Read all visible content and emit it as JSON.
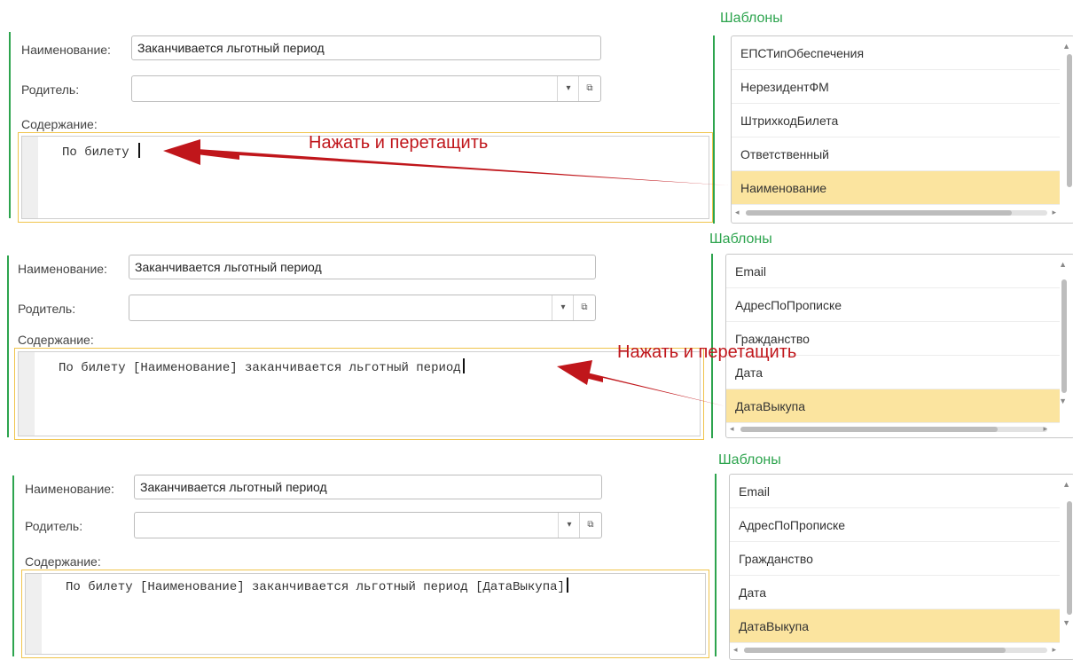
{
  "panels": [
    {
      "name_label": "Наименование:",
      "name_value": "Заканчивается льготный период",
      "parent_label": "Родитель:",
      "parent_value": "",
      "content_label": "Содержание:",
      "content_text": "По билету ",
      "templates_title": "Шаблоны",
      "templates": [
        "ЕПСТипОбеспечения",
        "НерезидентФМ",
        "ШтрихкодБилета",
        "Ответственный",
        "Наименование"
      ],
      "selected_index": 4,
      "annotation": "Нажать и перетащить"
    },
    {
      "name_label": "Наименование:",
      "name_value": "Заканчивается льготный период",
      "parent_label": "Родитель:",
      "parent_value": "",
      "content_label": "Содержание:",
      "content_text": "По билету [Наименование] заканчивается льготный период",
      "templates_title": "Шаблоны",
      "templates": [
        "Email",
        "АдресПоПрописке",
        "Гражданство",
        "Дата",
        "ДатаВыкупа"
      ],
      "selected_index": 4,
      "annotation": "Нажать и перетащить"
    },
    {
      "name_label": "Наименование:",
      "name_value": "Заканчивается льготный период",
      "parent_label": "Родитель:",
      "parent_value": "",
      "content_label": "Содержание:",
      "content_text": "По билету [Наименование] заканчивается льготный период [ДатаВыкупа]",
      "templates_title": "Шаблоны",
      "templates": [
        "Email",
        "АдресПоПрописке",
        "Гражданство",
        "Дата",
        "ДатаВыкупа"
      ],
      "selected_index": 4
    }
  ],
  "icons": {
    "dropdown": "chevron-down-icon",
    "open": "open-form-icon"
  },
  "colors": {
    "accent_green": "#2da44e",
    "selected_row": "#fbe49f",
    "focus_border": "#f0c44c",
    "annotation_red": "#c0161b"
  }
}
